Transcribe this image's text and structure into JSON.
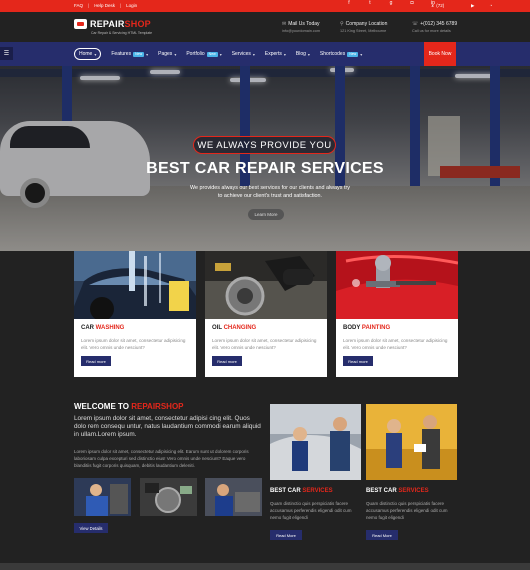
{
  "topbar": {
    "links": [
      "FAQ",
      "Help Desk",
      "Login"
    ],
    "social": [
      "facebook-icon",
      "twitter-icon",
      "googleplus-icon",
      "instagram-icon",
      "linkedin-icon"
    ],
    "cart": "(72)",
    "extra_social": [
      "youtube-icon",
      "rss-icon"
    ]
  },
  "header": {
    "logo_main": "REPAIR",
    "logo_accent": "SHOP",
    "tagline": "Car Repair & Servicing HTML Template",
    "mail_title": "Mail Us Today",
    "mail_sub": "info@yourdomain.com",
    "location_title": "Company Location",
    "location_sub": "121 King Street, Melbourne",
    "phone_title": "+(012) 345 6789",
    "phone_sub": "Call us for more details"
  },
  "nav": {
    "items": [
      {
        "label": "Home",
        "badge": ""
      },
      {
        "label": "Features",
        "badge": "New"
      },
      {
        "label": "Pages",
        "badge": ""
      },
      {
        "label": "Portfolio",
        "badge": "New"
      },
      {
        "label": "Services",
        "badge": ""
      },
      {
        "label": "Experts",
        "badge": ""
      },
      {
        "label": "Blog",
        "badge": ""
      },
      {
        "label": "Shortcodes",
        "badge": "New"
      }
    ],
    "book_label": "Book Now"
  },
  "hero": {
    "tag": "WE ALWAYS PROVIDE YOU",
    "title": "BEST CAR REPAIR SERVICES",
    "desc": "We provides always our best services for our clients and always try to achieve our client's trust and satisfaction.",
    "button": "Learn More"
  },
  "cards": [
    {
      "title_a": "CAR",
      "title_b": "WASHING",
      "text": "Lorem ipsum dolor sit amet, consectetur adipisicing elit. Vero omnis unde nesciunt?",
      "button": "Read more"
    },
    {
      "title_a": "OIL",
      "title_b": "CHANGING",
      "text": "Lorem ipsum dolor sit amet, consectetur adipisicing elit. Vero omnis unde nesciunt?",
      "button": "Read more"
    },
    {
      "title_a": "BODY",
      "title_b": "PAINTING",
      "text": "Lorem ipsum dolor sit amet, consectetur adipisicing elit. Vero omnis unde nesciunt?",
      "button": "Read more"
    }
  ],
  "welcome": {
    "title_a": "WELCOME TO",
    "title_b": "REPAIRSHOP",
    "lead": "Lorem ipsum dolor sit amet, consectetur adipisi cing elit. Quos dolo rem consequ untur, natus laudantium commodi earum aliquid in ullam.Lorem ipsum.",
    "body": "Lorem ipsum dolor sit amet, consectetur adipisicing elit. Earum sunt ut dolorem corporis laboriosam culpa excepturi sed distinctio eius! Vero omnis unde nesciunt? Eaque vero blanditiis fugit corporis quisquam, debitis laudantium deleniti.",
    "button": "View Details"
  },
  "blog": [
    {
      "title_a": "BEST CAR",
      "title_b": "SERVICES",
      "text": "Quam distinctio quis perspiciatis facere accusamus perferendis eligendi odit cum nemo fugit eligendi",
      "button": "Read More"
    },
    {
      "title_a": "BEST CAR",
      "title_b": "SERVICES",
      "text": "Quam distinctio quis perspiciatis facere accusamus perferendis eligendi odit cum nemo fugit eligendi",
      "button": "Read More"
    }
  ],
  "colors": {
    "accent": "#e4271b",
    "nav": "#262d6c",
    "dark": "#222222"
  }
}
